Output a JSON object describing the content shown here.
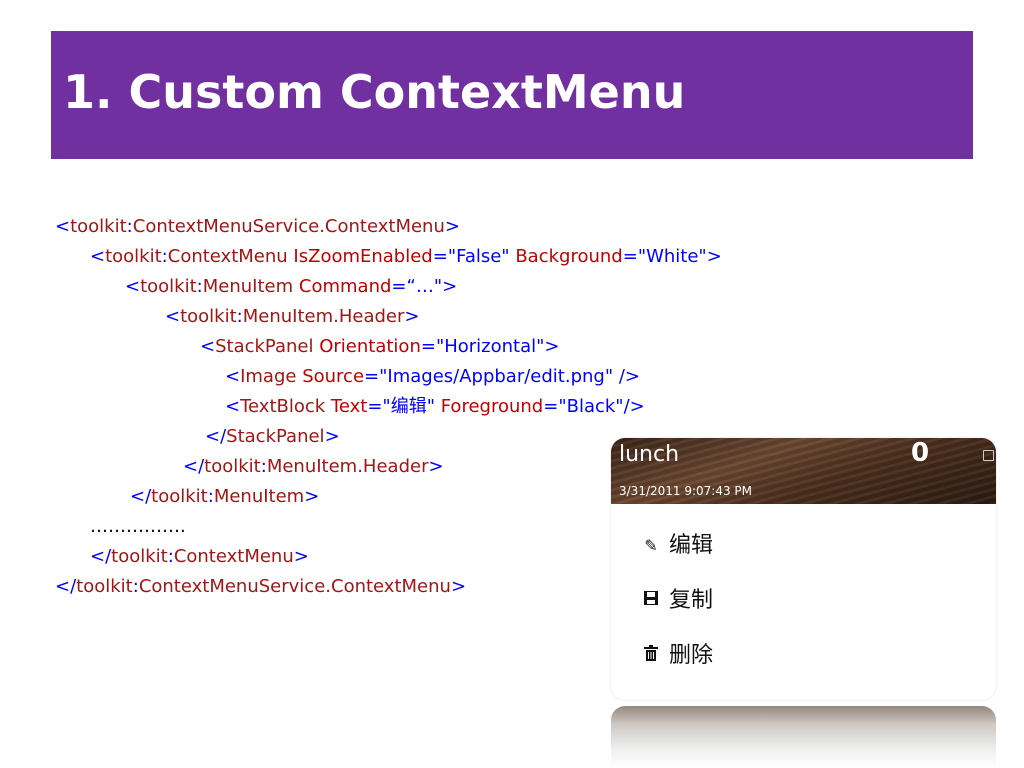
{
  "slide": {
    "title": "1. Custom ContextMenu",
    "accent_color": "#7030a0"
  },
  "code": {
    "line1": {
      "lt": "<",
      "ns": "toolkit",
      "colon": ":",
      "tag": "ContextMenuService.ContextMenu",
      "gt": ">"
    },
    "line2": {
      "lt": "<",
      "ns": "toolkit",
      "colon": ":",
      "tag": "ContextMenu",
      "a1": "IsZoomEnabled",
      "eq1": "=",
      "v1": "\"False\"",
      "a2": "Background",
      "eq2": "=",
      "v2": "\"White\"",
      "gt": ">"
    },
    "line3": {
      "lt": "<",
      "ns": "toolkit",
      "colon": ":",
      "tag": "MenuItem",
      "a1": "Command",
      "eq1": "=",
      "v1": "“…\"",
      "gt": ">"
    },
    "line4": {
      "lt": "<",
      "ns": "toolkit",
      "colon": ":",
      "tag": "MenuItem.Header",
      "gt": ">"
    },
    "line5": {
      "lt": "<",
      "tag": "StackPanel",
      "a1": "Orientation",
      "eq1": "=",
      "v1": "\"Horizontal\"",
      "gt": ">"
    },
    "line6": {
      "lt": "<",
      "tag": "Image",
      "a1": "Source",
      "eq1": "=",
      "v1": "\"Images/Appbar/edit.png\"",
      "end": " />"
    },
    "line7": {
      "lt": "<",
      "tag": "TextBlock",
      "a1": "Text",
      "eq1": "=",
      "v1": "\"编辑\"",
      "a2": "Foreground",
      "eq2": "=",
      "v2": "\"Black\"",
      "end": "/>"
    },
    "line8": {
      "lt": "</",
      "tag": "StackPanel",
      "gt": ">"
    },
    "line9": {
      "lt": "</",
      "ns": "toolkit",
      "colon": ":",
      "tag": "MenuItem.Header",
      "gt": ">"
    },
    "line10": {
      "lt": "</",
      "ns": "toolkit",
      "colon": ":",
      "tag": "MenuItem",
      "gt": ">"
    },
    "line11": {
      "text": "……………."
    },
    "line12": {
      "lt": "</",
      "ns": "toolkit",
      "colon": ":",
      "tag": "ContextMenu",
      "gt": ">"
    },
    "line13": {
      "lt": "</",
      "ns": "toolkit",
      "colon": ":",
      "tag": "ContextMenuService.ContextMenu",
      "gt": ">"
    }
  },
  "phone": {
    "title": "lunch",
    "count": "0",
    "date": "3/31/2011 9:07:43 PM",
    "menu": [
      {
        "icon": "edit-icon",
        "glyph": "✎",
        "label": "编辑"
      },
      {
        "icon": "save-icon",
        "glyph": "💾",
        "label": "复制"
      },
      {
        "icon": "trash-icon",
        "glyph": "🗑",
        "label": "删除"
      }
    ]
  },
  "colors": {
    "xml_delimiter": "#0000ff",
    "xml_tag": "#a31515",
    "xml_attribute": "#ff0000"
  }
}
